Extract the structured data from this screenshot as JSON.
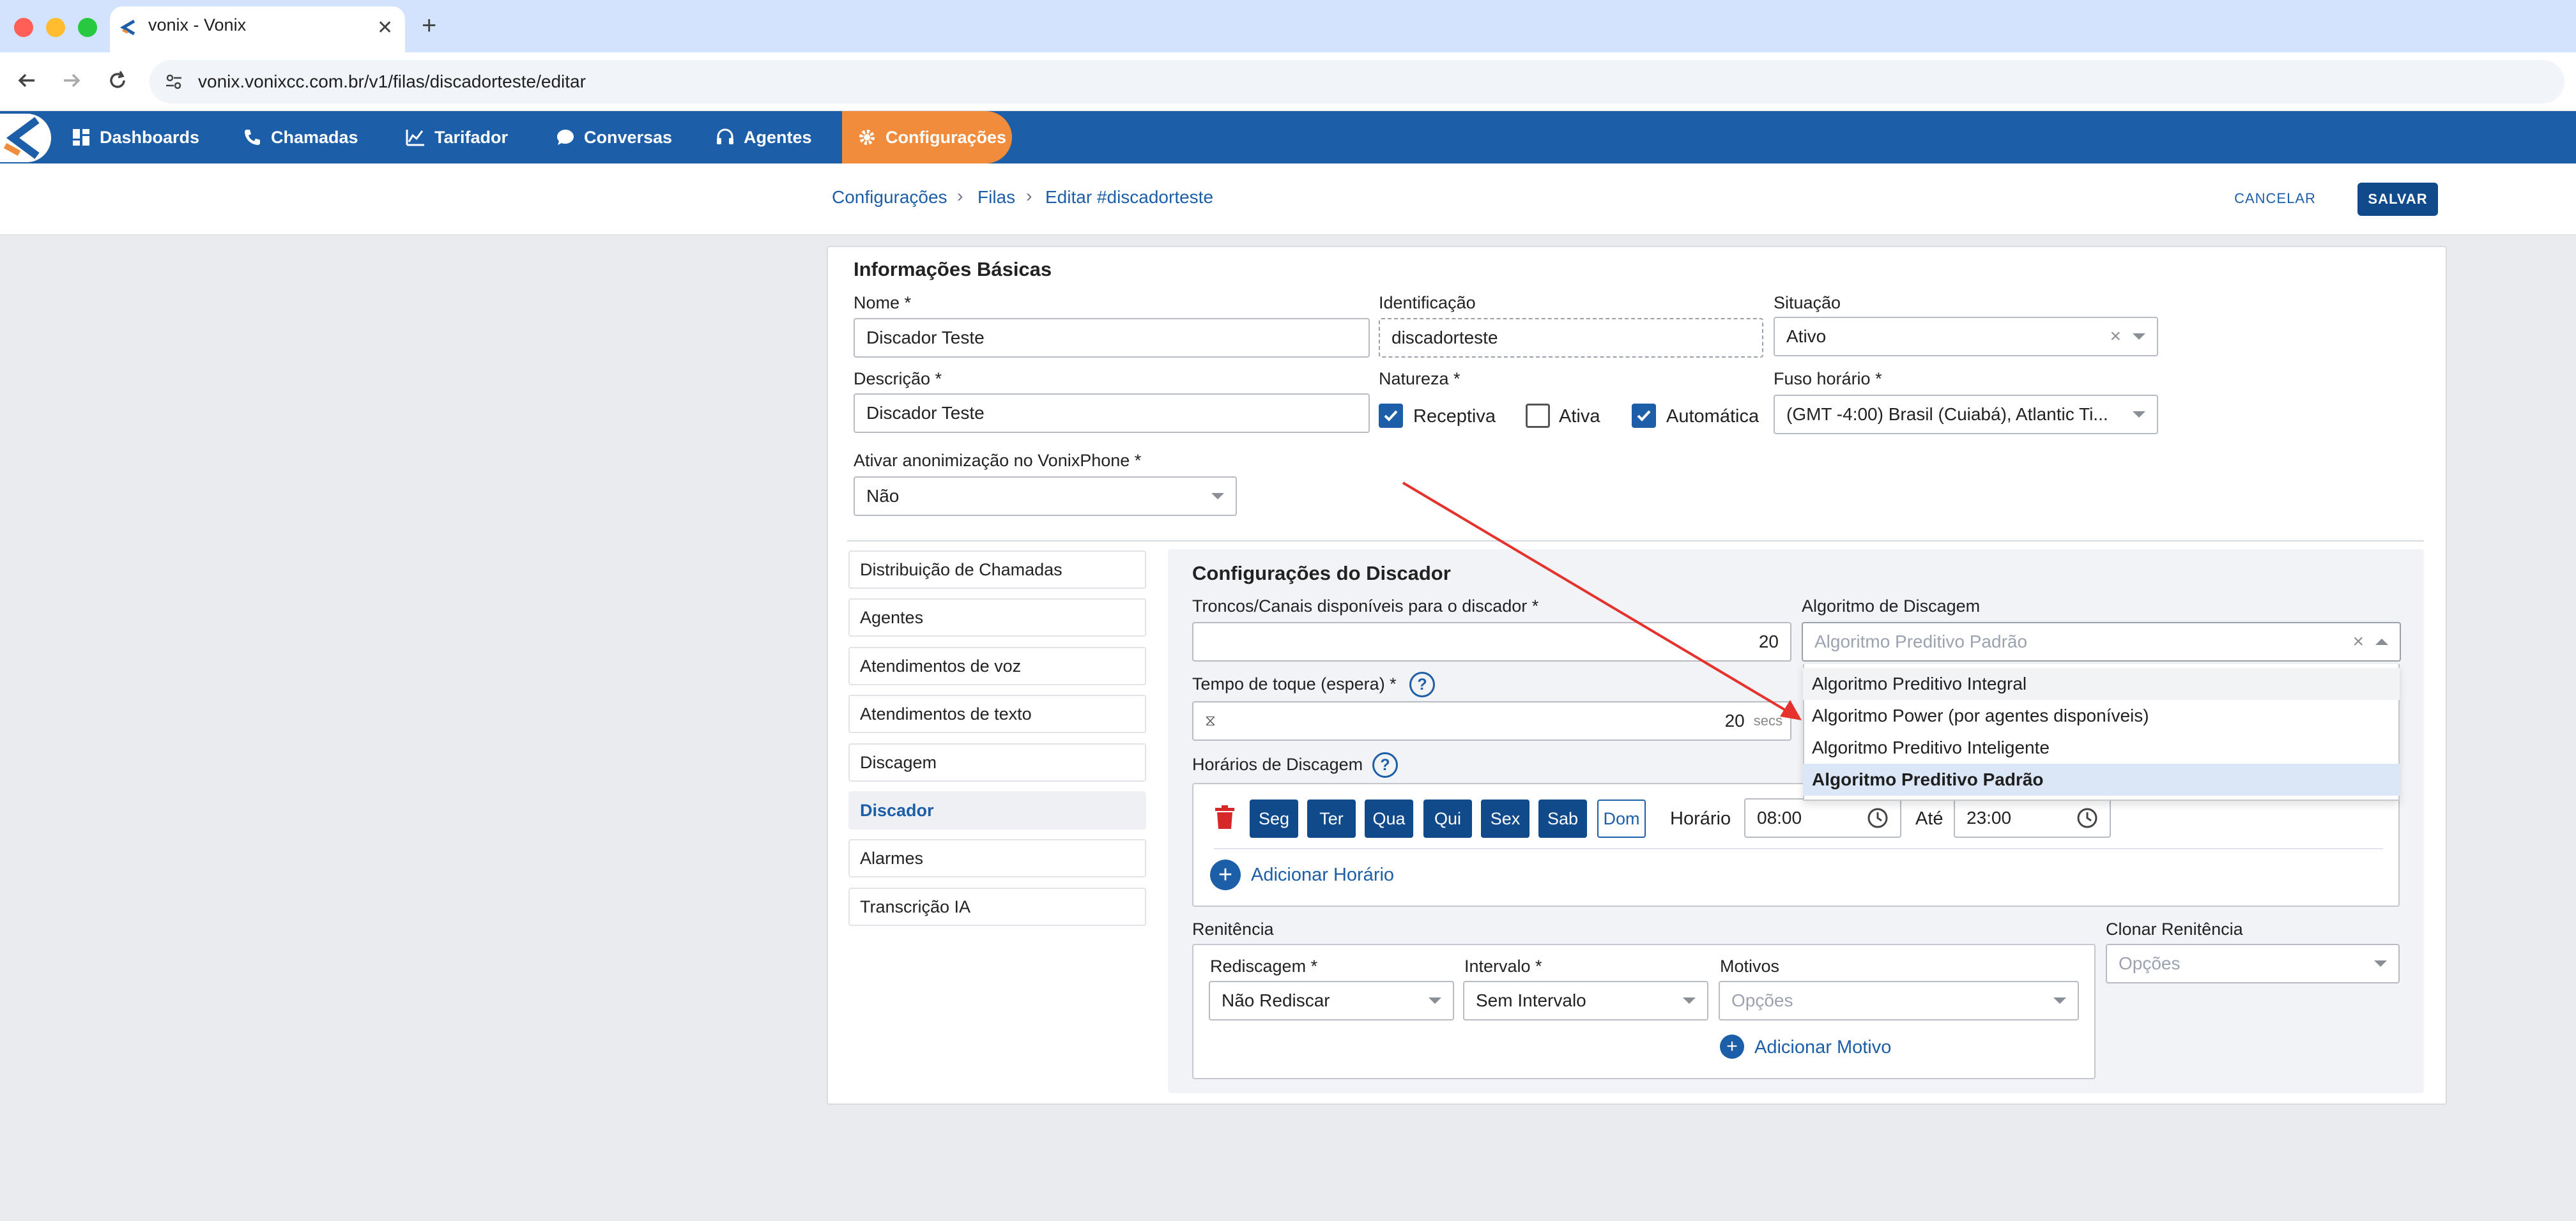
{
  "browser": {
    "tab_title": "vonix - Vonix",
    "new_tab": "+",
    "url": "vonix.vonixcc.com.br/v1/filas/discadorteste/editar"
  },
  "nav": {
    "items": [
      {
        "label": "Dashboards"
      },
      {
        "label": "Chamadas"
      },
      {
        "label": "Tarifador"
      },
      {
        "label": "Conversas"
      },
      {
        "label": "Agentes"
      },
      {
        "label": "Configurações"
      }
    ],
    "accent": "#f08c3c",
    "bar_color": "#1d5ea8"
  },
  "breadcrumb": [
    "Configurações",
    "Filas",
    "Editar #discadorteste"
  ],
  "actions": {
    "cancel": "CANCELAR",
    "save": "SALVAR"
  },
  "basic": {
    "title": "Informações Básicas",
    "nome_label": "Nome *",
    "nome_value": "Discador Teste",
    "ident_label": "Identificação",
    "ident_value": "discadorteste",
    "situacao_label": "Situação",
    "situacao_value": "Ativo",
    "desc_label": "Descrição *",
    "desc_value": "Discador Teste",
    "natureza_label": "Natureza *",
    "natureza": [
      {
        "label": "Receptiva",
        "checked": true
      },
      {
        "label": "Ativa",
        "checked": false
      },
      {
        "label": "Automática",
        "checked": true
      }
    ],
    "fuso_label": "Fuso horário *",
    "fuso_value": "(GMT -4:00) Brasil (Cuiabá), Atlantic Ti...",
    "anon_label": "Ativar anonimização no VonixPhone *",
    "anon_value": "Não"
  },
  "sidemenu": [
    {
      "label": "Distribuição de Chamadas",
      "active": false
    },
    {
      "label": "Agentes",
      "active": false
    },
    {
      "label": "Atendimentos de voz",
      "active": false
    },
    {
      "label": "Atendimentos de texto",
      "active": false
    },
    {
      "label": "Discagem",
      "active": false
    },
    {
      "label": "Discador",
      "active": true
    },
    {
      "label": "Alarmes",
      "active": false
    },
    {
      "label": "Transcrição IA",
      "active": false
    }
  ],
  "discador": {
    "title": "Configurações do Discador",
    "troncos_label": "Troncos/Canais disponíveis para o discador *",
    "troncos_value": "20",
    "algoritmo_label": "Algoritmo de Discagem",
    "algoritmo_placeholder": "Algoritmo Preditivo Padrão",
    "algoritmo_options": [
      "Algoritmo Preditivo Integral",
      "Algoritmo Power (por agentes disponíveis)",
      "Algoritmo Preditivo Inteligente",
      "Algoritmo Preditivo Padrão"
    ],
    "toque_label": "Tempo de toque (espera) *",
    "toque_value": "20",
    "toque_unit": "secs",
    "help": "?",
    "horarios_label": "Horários de Discagem",
    "days": [
      {
        "label": "Seg",
        "active": true
      },
      {
        "label": "Ter",
        "active": true
      },
      {
        "label": "Qua",
        "active": true
      },
      {
        "label": "Qui",
        "active": true
      },
      {
        "label": "Sex",
        "active": true
      },
      {
        "label": "Sab",
        "active": true
      },
      {
        "label": "Dom",
        "active": false
      }
    ],
    "horario_label": "Horário",
    "horario_start": "08:00",
    "ate_label": "Até",
    "horario_end": "23:00",
    "add_horario": "Adicionar Horário",
    "plus": "+",
    "renitencia_label": "Renitência",
    "rediscagem_label": "Rediscagem *",
    "rediscagem_value": "Não Rediscar",
    "intervalo_label": "Intervalo *",
    "intervalo_value": "Sem Intervalo",
    "motivos_label": "Motivos",
    "motivos_placeholder": "Opções",
    "add_motivo": "Adicionar Motivo",
    "clonar_label": "Clonar Renitência",
    "clonar_placeholder": "Opções"
  }
}
